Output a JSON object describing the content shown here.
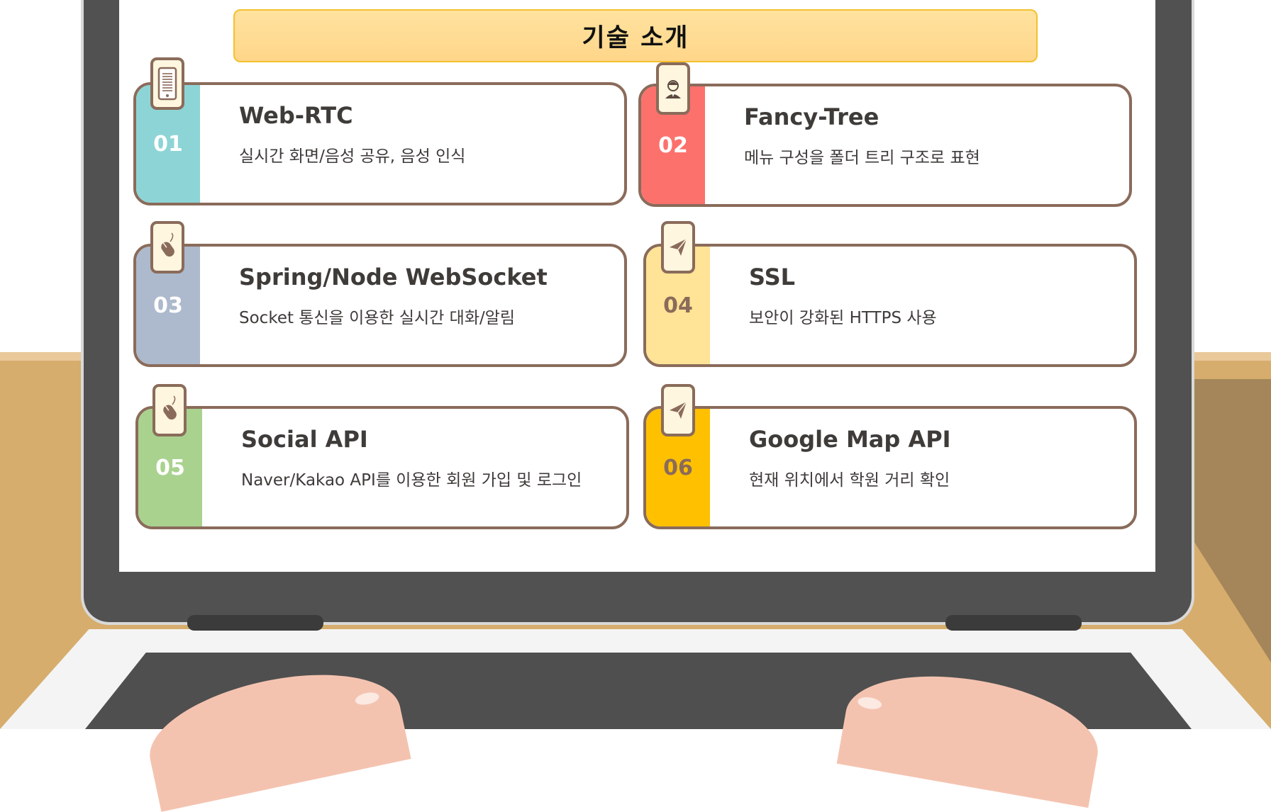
{
  "title": "기술 소개",
  "cards": [
    {
      "num": "01",
      "title": "Web-RTC",
      "desc": "실시간 화면/음성 공유, 음성 인식",
      "color": "#8dd4d6",
      "icon": "phone-icon"
    },
    {
      "num": "02",
      "title": "Fancy-Tree",
      "desc": "메뉴 구성을 폴더 트리 구조로 표현",
      "color": "#fd716d",
      "icon": "user-icon"
    },
    {
      "num": "03",
      "title": "Spring/Node WebSocket",
      "desc": "Socket 통신을 이용한 실시간 대화/알림",
      "color": "#adb9cc",
      "icon": "mouse-icon"
    },
    {
      "num": "04",
      "title": "SSL",
      "desc": "보안이 강화된 HTTPS 사용",
      "color": "#ffe396",
      "icon": "paper-plane-icon"
    },
    {
      "num": "05",
      "title": "Social API",
      "desc": "Naver/Kakao API를 이용한 회원 가입 및 로그인",
      "color": "#a9d28f",
      "icon": "mouse-icon"
    },
    {
      "num": "06",
      "title": "Google Map API",
      "desc": "현재 위치에서 학원 거리 확인",
      "color": "#ffc000",
      "icon": "paper-plane-icon"
    }
  ]
}
